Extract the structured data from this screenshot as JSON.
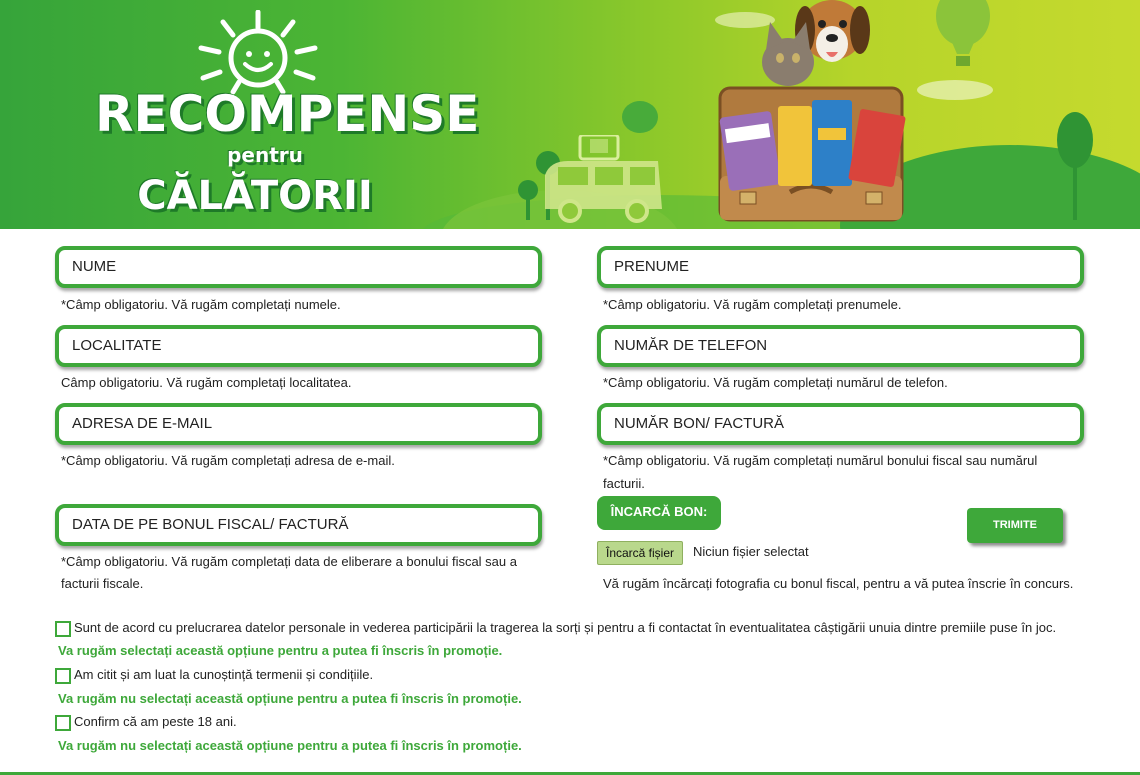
{
  "banner": {
    "title_line1": "RECOMPENSE",
    "title_line2": "pentru",
    "title_line3": "CĂLĂTORII",
    "icons": [
      "sun-icon",
      "pets-suitcase-illustration",
      "van-icon",
      "balloon-icon"
    ]
  },
  "form": {
    "fields": [
      {
        "placeholder": "NUME",
        "hint": "*Câmp obligatoriu. Vă rugăm completați numele."
      },
      {
        "placeholder": "PRENUME",
        "hint": "*Câmp obligatoriu. Vă rugăm completați prenumele."
      },
      {
        "placeholder": "LOCALITATE",
        "hint": "Câmp obligatoriu. Vă rugăm completați localitatea."
      },
      {
        "placeholder": "NUMĂR DE TELEFON",
        "hint": "*Câmp obligatoriu. Vă rugăm completați numărul de telefon."
      },
      {
        "placeholder": "ADRESA DE E-MAIL",
        "hint": "*Câmp obligatoriu. Vă rugăm completați adresa de e-mail."
      },
      {
        "placeholder": "NUMĂR BON/ FACTURĂ",
        "hint_line1": "*Câmp obligatoriu. Vă rugăm completați numărul bonului fiscal sau numărul",
        "hint_line2": "facturii."
      },
      {
        "placeholder": "DATA DE PE BONUL FISCAL/ FACTURĂ",
        "hint_line1": "*Câmp obligatoriu. Vă rugăm completați data de eliberare a bonului fiscal sau a",
        "hint_line2": "facturii fiscale."
      }
    ],
    "upload": {
      "button_label": "ÎNCARCĂ BON:",
      "file_button_label": "Încarcă fișier",
      "file_status": "Niciun fișier selectat",
      "hint": "Vă rugăm încărcați fotografia cu bonul fiscal, pentru a vă putea înscrie în concurs."
    },
    "submit_label": "TRIMITE",
    "checkboxes": [
      {
        "label": "Sunt de acord cu prelucrarea datelor personale in vederea participării la tragerea la sorți și pentru a fi contactat în eventualitatea câștigării unuia dintre premiile puse în joc.",
        "warning": "Va rugăm selectați această opțiune pentru a putea fi înscris în promoție.",
        "checked": false
      },
      {
        "label": "Am citit și am luat la cunoștință termenii și condițiile.",
        "warning": "Va rugăm nu selectați această opțiune pentru a putea fi înscris în promoție.",
        "checked": false
      },
      {
        "label": "Confirm că am peste 18 ani.",
        "warning": "Va rugăm nu selectați această opțiune pentru a putea fi înscris în promoție.",
        "checked": false
      }
    ]
  },
  "colors": {
    "brand_green": "#3ea83a",
    "file_button": "#b9d88c"
  }
}
